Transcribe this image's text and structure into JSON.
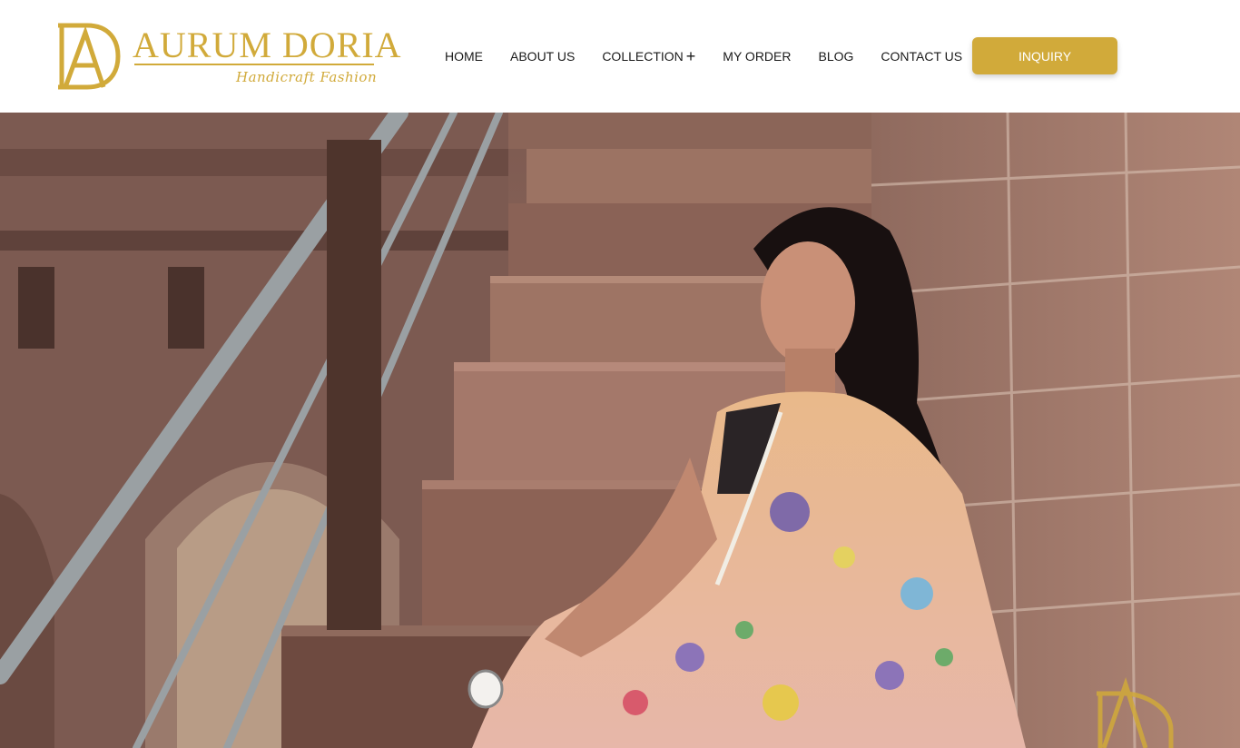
{
  "brand": {
    "name": "AURUM DORIA",
    "tagline": "Handicraft Fashion",
    "logo_icon": "ad-monogram-icon",
    "accent_color": "#d1aa3a"
  },
  "nav": {
    "items": [
      {
        "label": "HOME"
      },
      {
        "label": "ABOUT US"
      },
      {
        "label": "COLLECTION",
        "icon": "plus-icon",
        "icon_glyph": "+"
      },
      {
        "label": "MY ORDER"
      },
      {
        "label": "BLOG"
      },
      {
        "label": "CONTACT US"
      }
    ],
    "cta_label": "INQUIRY"
  },
  "hero": {
    "image": "woman-in-saree-on-stone-stairs",
    "watermark_icon": "ad-monogram-icon"
  }
}
